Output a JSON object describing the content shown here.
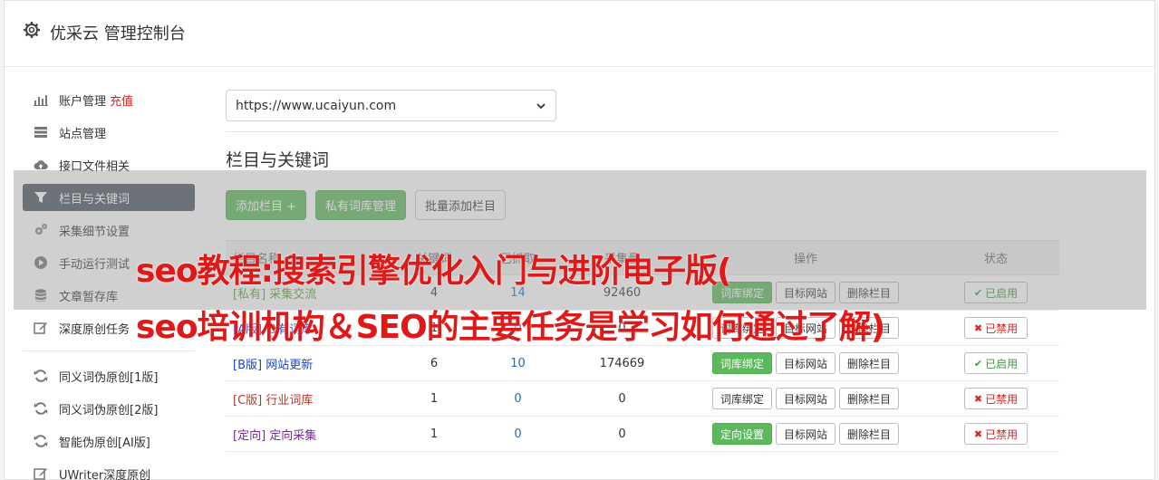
{
  "header": {
    "title": "优采云 管理控制台",
    "icon": "gear-icon"
  },
  "sidebar": {
    "items": [
      {
        "label": "账户管理",
        "extra": "充值",
        "icon": "bar-chart-icon"
      },
      {
        "label": "站点管理",
        "icon": "server-icon"
      },
      {
        "label": "接口文件相关",
        "icon": "cloud-upload-icon"
      },
      {
        "label": "栏目与关键词",
        "icon": "filter-icon",
        "active": true
      },
      {
        "label": "采集细节设置",
        "icon": "gears-icon"
      },
      {
        "label": "手动运行测试",
        "icon": "play-circle-icon"
      },
      {
        "label": "文章暂存库",
        "icon": "database-icon"
      },
      {
        "label": "深度原创任务",
        "icon": "edit-icon"
      }
    ],
    "items2": [
      {
        "label": "同义词伪原创[1版]",
        "icon": "refresh-icon"
      },
      {
        "label": "同义词伪原创[2版]",
        "icon": "refresh-icon"
      },
      {
        "label": "智能伪原创[AI版]",
        "icon": "refresh-icon"
      },
      {
        "label": "UWriter深度原创",
        "icon": "edit-icon"
      }
    ]
  },
  "main": {
    "site_select": "https://www.ucaiyun.com",
    "section_title": "栏目与关键词",
    "buttons": {
      "add": "添加栏目 +",
      "private_lib": "私有词库管理",
      "batch_add": "批量添加栏目"
    },
    "table": {
      "headers": [
        "栏目名称",
        "关键词",
        "已抓取",
        "采集量",
        "操作",
        "状态"
      ],
      "rows": [
        {
          "tag": "[私有]",
          "name": "采集交流",
          "kw": "4",
          "fetched": "14",
          "count": "92460",
          "op1": "词库绑定",
          "op1_green": true,
          "op2": "目标网站",
          "op3": "删除栏目",
          "status": "已启用",
          "on": true,
          "color": "green"
        },
        {
          "tag": "[A版]",
          "name": "公有词库",
          "kw": "1",
          "fetched": "0",
          "count": "0",
          "op1": "词库绑定",
          "op1_green": false,
          "op2": "目标网站",
          "op3": "删除栏目",
          "status": "已禁用",
          "on": false,
          "color": "blue"
        },
        {
          "tag": "[B版]",
          "name": "网站更新",
          "kw": "6",
          "fetched": "10",
          "count": "174669",
          "op1": "词库绑定",
          "op1_green": true,
          "op2": "目标网站",
          "op3": "删除栏目",
          "status": "已启用",
          "on": true,
          "color": "blue"
        },
        {
          "tag": "[C版]",
          "name": "行业词库",
          "kw": "1",
          "fetched": "0",
          "count": "0",
          "op1": "词库绑定",
          "op1_green": false,
          "op2": "目标网站",
          "op3": "删除栏目",
          "status": "已禁用",
          "on": false,
          "color": "red"
        },
        {
          "tag": "[定向]",
          "name": "定向采集",
          "kw": "1",
          "fetched": "0",
          "count": "0",
          "op1": "定向设置",
          "op1_green": true,
          "op2": "目标网站",
          "op3": "删除栏目",
          "status": "已禁用",
          "on": false,
          "color": "purple"
        }
      ]
    }
  },
  "watermark": {
    "line1": "seo教程:搜索引擎优化入门与进阶电子版(",
    "line2": "seo培训机构＆SEO的主要任务是学习如何通过了解)"
  }
}
